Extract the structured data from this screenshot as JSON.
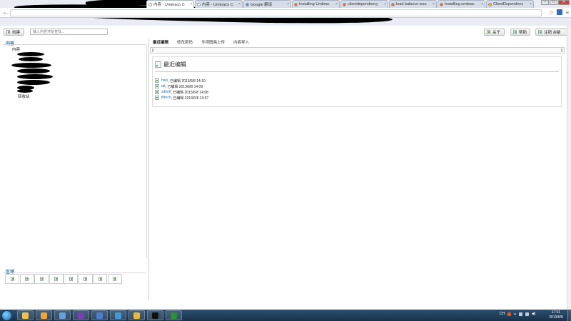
{
  "browser": {
    "tabs": [
      {
        "title": "内容 - Umbraco C",
        "active": true,
        "favicon_color": "#ffffff"
      },
      {
        "title": "内容 - Umbraco C",
        "active": false,
        "favicon_color": "#ffffff"
      },
      {
        "title": "Google 翻译",
        "active": false,
        "favicon_color": "#4a8cf0"
      },
      {
        "title": "Installing Umbrac",
        "active": false,
        "favicon_color": "#e8703a"
      },
      {
        "title": "clientdependency",
        "active": false,
        "favicon_color": "#e8703a"
      },
      {
        "title": "load balance issu",
        "active": false,
        "favicon_color": "#e8703a"
      },
      {
        "title": "Installing umbrac",
        "active": false,
        "favicon_color": "#e8703a"
      },
      {
        "title": "ClientDependenc",
        "active": false,
        "favicon_color": "#f2b705"
      }
    ],
    "back_icon": "arrow-left-icon",
    "star_icon": "star-icon",
    "menu_icon": "menu-icon"
  },
  "actions": {
    "create_label": "创建",
    "search_placeholder": "输入内容开始查找...",
    "about_label": "关于",
    "help_label": "帮助",
    "logout_label": "注销 余敏"
  },
  "left": {
    "content_title": "内容",
    "tree_root": "内容",
    "recycle_bin": "回收站",
    "sections_title": "区域",
    "section_icon_count": 8
  },
  "right": {
    "tabs": [
      "最近编辑",
      "修改密码",
      "专项图画上传",
      "内容导入"
    ],
    "card_title": "最近编辑",
    "edits": [
      {
        "name": "hsei",
        "text": ", 已编辑 2013/6/8 14:10"
      },
      {
        "name": "dd",
        "text": ", 已编辑 2013/6/8 14:09"
      },
      {
        "name": "sdfsdf",
        "text": ", 已编辑 2013/6/8 14:08"
      },
      {
        "name": "fbfech",
        "text": ", 已编辑 2013/6/8 13:37"
      }
    ]
  },
  "taskbar": {
    "apps": [
      {
        "name": "explorer",
        "color": "#f1c24b"
      },
      {
        "name": "outlook",
        "color": "#f2a33a"
      },
      {
        "name": "app3",
        "color": "#6aa0d8"
      },
      {
        "name": "visual-studio",
        "color": "#7a3fb3"
      },
      {
        "name": "app5",
        "color": "#4a7ed0"
      },
      {
        "name": "app6",
        "color": "#3f98d8"
      },
      {
        "name": "chrome",
        "color": "#e8b93a"
      },
      {
        "name": "cmd",
        "color": "#111111"
      },
      {
        "name": "excel",
        "color": "#2f8f3a"
      }
    ],
    "lang": "CH",
    "time": "17:11",
    "date": "2013/6/8"
  }
}
